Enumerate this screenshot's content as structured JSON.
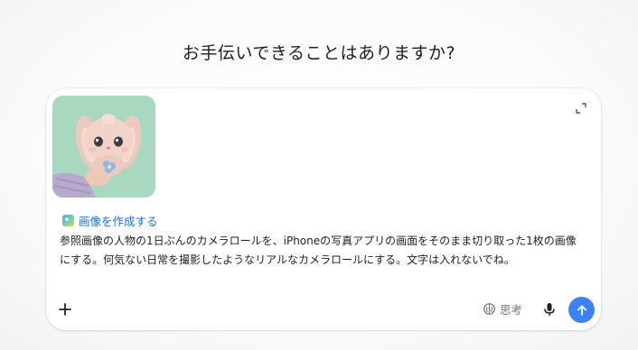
{
  "heading": "お手伝いできることはありますか?",
  "attachment": {
    "icon": "plush-bunny-photo-icon"
  },
  "expand": {
    "icon": "expand-icon"
  },
  "tool_chip": {
    "label": "画像を作成する",
    "icon": "image-create-icon",
    "color": "#1a73e8"
  },
  "prompt": {
    "text": "参照画像の人物の1日ぶんのカメラロールを、iPhoneの写真アプリの画面をそのまま切り取った1枚の画像にする。何気ない日常を撮影したようなリアルなカメラロールにする。文字は入れないでね。"
  },
  "toolbar": {
    "add_icon": "plus-icon",
    "think_label": "思考",
    "think_icon": "brain-icon",
    "mic_icon": "microphone-icon",
    "send_icon": "arrow-up-icon",
    "send_color": "#3b82f6"
  }
}
